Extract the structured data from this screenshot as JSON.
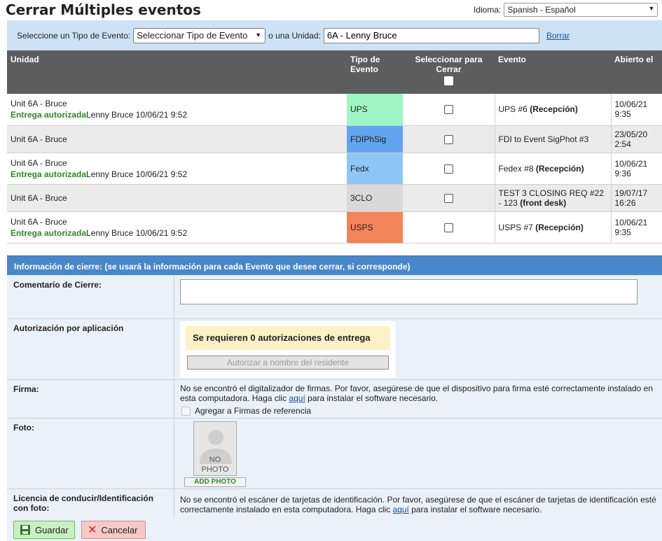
{
  "page": {
    "title": "Cerrar Múltiples eventos",
    "language_label": "Idioma:",
    "language_value": "Spanish - Español"
  },
  "filter": {
    "type_label": "Seleccione un Tipo de Evento:",
    "type_value": "Seleccionar Tipo de Evento",
    "unit_label": "o una Unidad:",
    "unit_value": "6A - Lenny Bruce",
    "clear_link": "Borrar"
  },
  "table": {
    "headers": {
      "unit": "Unidad",
      "type": "Tipo de Evento",
      "select": "Seleccionar para Cerrar",
      "event": "Evento",
      "opened": "Abierto el"
    },
    "rows": [
      {
        "unit": "Unit 6A - Bruce",
        "auth_label": "Entrega autorizada",
        "auth_detail": "Lenny Bruce 10/06/21 9:52",
        "type": "UPS",
        "type_color": "#9ff5c4",
        "event_name": "UPS #6",
        "event_tag": "(Recepción)",
        "opened_date": "10/06/21",
        "opened_time": "9:35"
      },
      {
        "unit": "Unit 6A - Bruce",
        "auth_label": "",
        "auth_detail": "",
        "type": "FDIPhSig",
        "type_color": "#63a4f0",
        "event_name": "FDI to Event SigPhot #3",
        "event_tag": "",
        "opened_date": "23/05/20",
        "opened_time": "2:54"
      },
      {
        "unit": "Unit 6A - Bruce",
        "auth_label": "Entrega autorizada",
        "auth_detail": "Lenny Bruce 10/06/21 9:52",
        "type": "Fedx",
        "type_color": "#8fc6f6",
        "event_name": "Fedex #8",
        "event_tag": "(Recepción)",
        "opened_date": "10/06/21",
        "opened_time": "9:36"
      },
      {
        "unit": "Unit 6A - Bruce",
        "auth_label": "",
        "auth_detail": "",
        "type": "3CLO",
        "type_color": "#d9d9d9",
        "event_name": "TEST 3 CLOSING REQ #22 - 123",
        "event_tag": "(front desk)",
        "opened_date": "19/07/17",
        "opened_time": "16:26"
      },
      {
        "unit": "Unit 6A - Bruce",
        "auth_label": "Entrega autorizada",
        "auth_detail": "Lenny Bruce 10/06/21 9:52",
        "type": "USPS",
        "type_color": "#f2845a",
        "event_name": "USPS #7",
        "event_tag": "(Recepción)",
        "opened_date": "10/06/21",
        "opened_time": "9:35"
      }
    ]
  },
  "close_info": {
    "header": "Información de cierre: (se usará la información para cada Evento que desee cerrar, si corresponde)",
    "comment_label": "Comentario de Cierre:",
    "comment_value": "",
    "auth_label": "Autorización por aplicación",
    "auth_note": "Se requieren 0 autorizaciones de entrega",
    "auth_button": "Autorizar a nombre del residente",
    "signature_label": "Firma:",
    "signature_text_1": "No se encontró el digitalizador de firmas. Por favor, asegúrese de que el dispositivo para firma esté correctamente instalado en esta computadora. Haga clic",
    "signature_link": "aquí",
    "signature_text_2": "para instalar el software necesario.",
    "signature_checkbox_label": "Agregar a Firmas de referencia",
    "photo_label": "Foto:",
    "photo_placeholder_1": "NO",
    "photo_placeholder_2": "PHOTO",
    "add_photo": "ADD PHOTO",
    "license_label": "Licencia de conducir/Identificación con foto:",
    "license_text_1": "No se encontró el escáner de tarjetas de identificación. Por favor, asegúrese de que el escáner de tarjetas de identificación esté correctamente instalado en esta computadora. Haga clic",
    "license_link": "aquí",
    "license_text_2": "para instalar el software necesario."
  },
  "actions": {
    "save": "Guardar",
    "cancel": "Cancelar"
  }
}
